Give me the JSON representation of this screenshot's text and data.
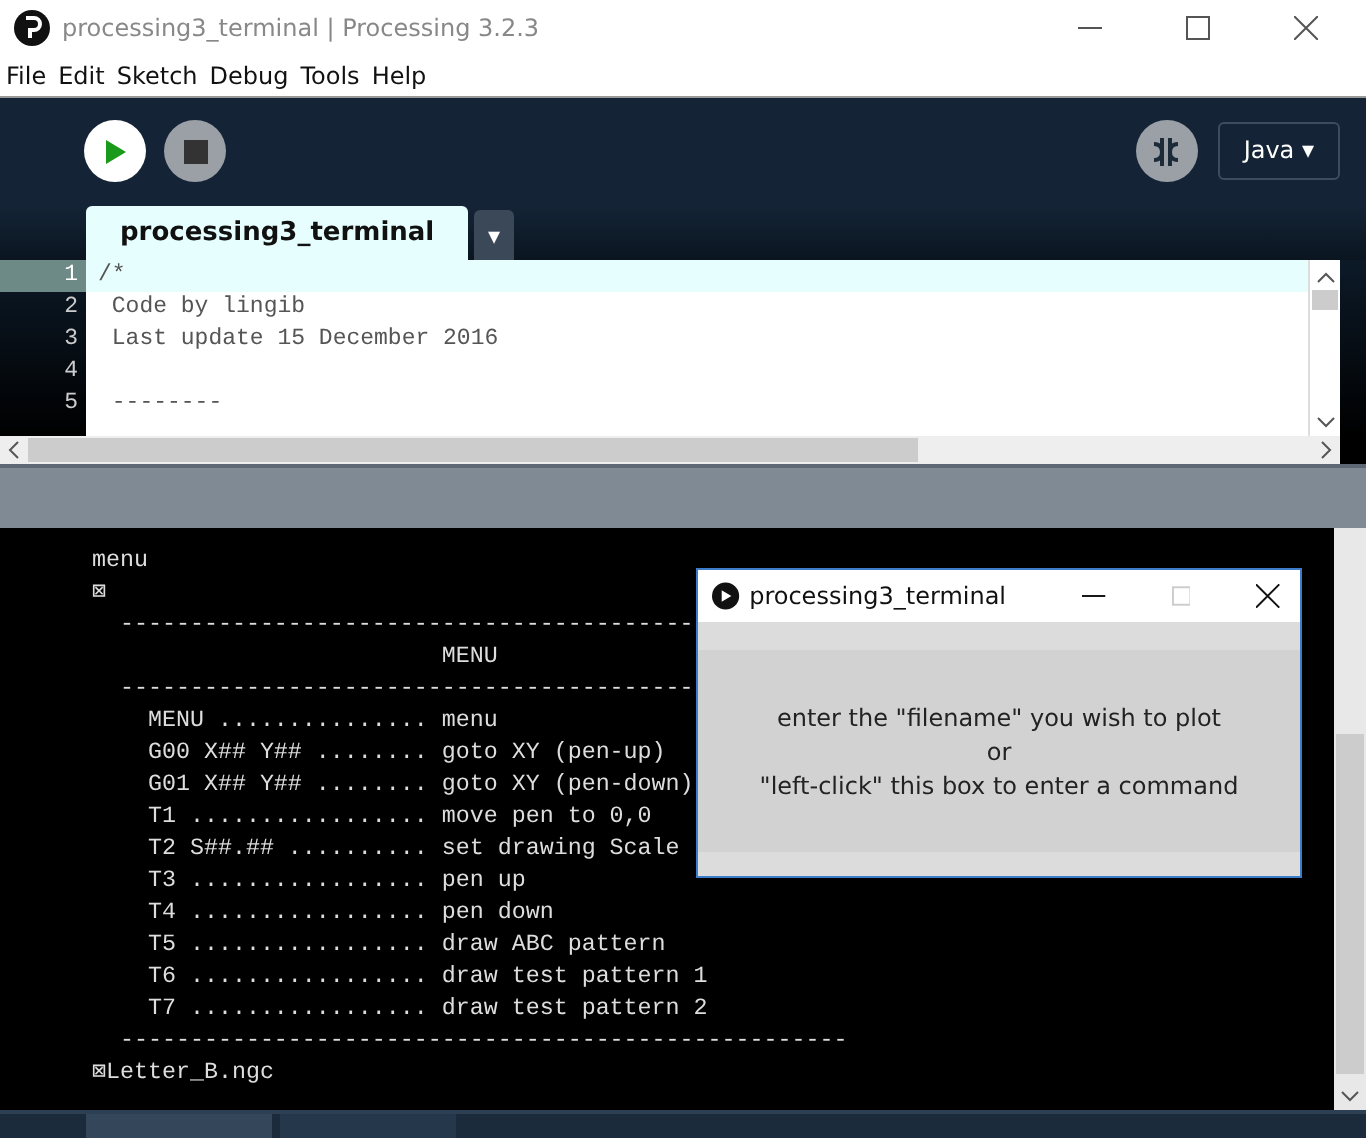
{
  "window": {
    "title": "processing3_terminal | Processing 3.2.3"
  },
  "menu": [
    "File",
    "Edit",
    "Sketch",
    "Debug",
    "Tools",
    "Help"
  ],
  "toolbar": {
    "mode": "Java ▾"
  },
  "tabs": [
    {
      "label": "processing3_terminal",
      "selected": true
    }
  ],
  "tab_menu": "▾",
  "editor": {
    "lines": [
      {
        "number": "1",
        "code": "/*",
        "current": true
      },
      {
        "number": "2",
        "code": " Code by lingib",
        "current": false
      },
      {
        "number": "3",
        "code": " Last update 15 December 2016",
        "current": false
      },
      {
        "number": "4",
        "current": false
      },
      {
        "number": "5",
        "code": " --------",
        "current": false
      }
    ]
  },
  "console": {
    "lines": [
      "menu",
      "⊠",
      "  -----------------------------------------",
      "                         MENU",
      "  -----------------------------------------",
      "    MENU ............... menu",
      "    G00 X## Y## ........ goto XY (pen-up)",
      "    G01 X## Y## ........ goto XY (pen-down)",
      "    T1 ................. move pen to 0,0",
      "    T2 S##.## .......... set drawing Scale",
      "    T3 ................. pen up",
      "    T4 ................. pen down",
      "    T5 ................. draw ABC pattern",
      "    T6 ................. draw test pattern 1",
      "    T7 ................. draw test pattern 2",
      "  ----------------------------------------------------",
      "⊠Letter_B.ngc"
    ]
  },
  "sketch_window": {
    "title": "processing3_terminal",
    "message": [
      "enter the \"filename\" you wish to plot",
      "or",
      "\"left-click\" this box to enter a command"
    ]
  }
}
